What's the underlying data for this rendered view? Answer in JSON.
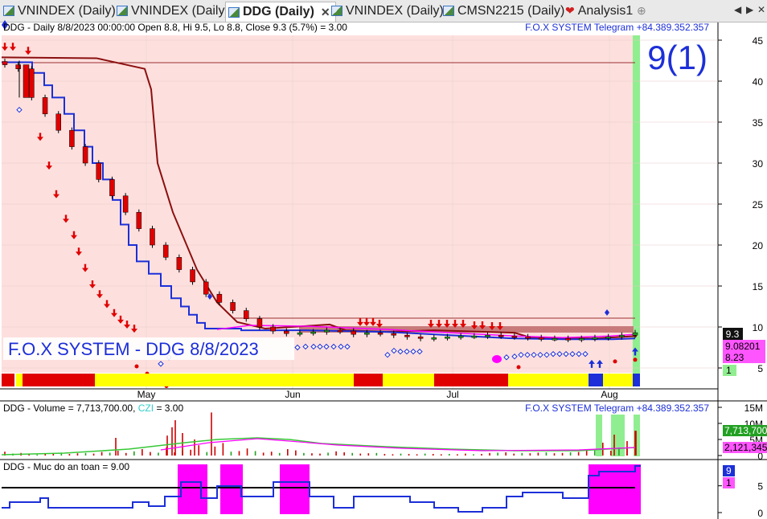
{
  "tabs": [
    {
      "label": "VNINDEX (Daily)",
      "active": false
    },
    {
      "label": "VNINDEX (Daily)",
      "active": false
    },
    {
      "label": "DDG (Daily)",
      "active": true
    },
    {
      "label": "VNINDEX (Daily)",
      "active": false
    },
    {
      "label": "CMSN2215 (Daily)",
      "active": false
    },
    {
      "label": "Analysis1",
      "active": false
    }
  ],
  "tab_add_label": "⊕",
  "nav_labels": [
    "◀",
    "▶",
    "✕"
  ],
  "colors": {
    "price_bg": "#fde0de",
    "up": "#22a022",
    "down": "#e00000",
    "blue_line": "#1c2fd8",
    "darkred_line": "#8b0f0f",
    "magenta": "#ff00ff",
    "green_band": "#90ee90",
    "yellow": "#ffff00",
    "volume_ma": "#36c836"
  },
  "price_panel": {
    "info_text": "DDG - Daily 8/8/2023 00:00:00 Open 8.8, Hi 9.5, Lo 8.8, Close 9.3 (5.7%)  = 3.00",
    "brand_text": "F.O.X SYSTEM Telegram +84.389.352.357",
    "signal_text": "9(1)",
    "watermark": "F.O.X SYSTEM - DDG 8/8/2023",
    "x_labels": [
      "May",
      "Jun",
      "Jul",
      "Aug"
    ],
    "y_ticks": [
      "45",
      "40",
      "35",
      "30",
      "25",
      "20",
      "15",
      "10",
      "5"
    ],
    "last_price_label": "9.3",
    "indicator_label_1": "9.08201",
    "indicator_label_2": "8.23",
    "indicator_label_3": "1"
  },
  "volume_panel": {
    "info_prefix": "DDG - Volume = 7,713,700.00, ",
    "info_czi": "CZI",
    "info_suffix": " = 3.00",
    "brand_text": "F.O.X SYSTEM Telegram +84.389.352.357",
    "y_ticks": [
      "15M",
      "10M",
      "5M",
      "0"
    ],
    "value_label_1": "7,713,700",
    "value_label_2": "2,121,345"
  },
  "safety_panel": {
    "info_text": "DDG - Muc do an toan = 9.00",
    "y_ticks": [
      "5",
      "0"
    ],
    "value_label_1": "9",
    "value_label_2": "1"
  },
  "chart_data": [
    {
      "type": "bar",
      "title": "",
      "series": [
        {
          "name": "DDG",
          "ohlc_last": {
            "open": 8.8,
            "high": 9.5,
            "low": 8.8,
            "close": 9.3
          }
        }
      ],
      "x_labels": [
        "May",
        "Jun",
        "Jul",
        "Aug"
      ],
      "close_approx": [
        42,
        41.5,
        38,
        36,
        34,
        32,
        30,
        28,
        26,
        24,
        22,
        20,
        18.5,
        17,
        15.5,
        14,
        13,
        12,
        11,
        10,
        9.5,
        9.2,
        9.3,
        9.4,
        9.6,
        9.5,
        9.1,
        9.3,
        9.2,
        9.0,
        8.8,
        8.6,
        8.7,
        8.8,
        8.9,
        8.9,
        9.0,
        8.9,
        8.8,
        8.7,
        8.6,
        8.6,
        8.5,
        8.6,
        8.7,
        8.8,
        9.0,
        9.3
      ],
      "resistance_line": 42.3,
      "box_top": 11.1,
      "ylim": [
        0,
        47
      ]
    },
    {
      "type": "bar",
      "title": "",
      "series": [
        {
          "name": "Volume",
          "last": 7713700
        },
        {
          "name": "CZI",
          "last": 3.0
        }
      ],
      "ylim": [
        0,
        15000000
      ]
    },
    {
      "type": "line",
      "title": "",
      "series": [
        {
          "name": "Muc do an toan",
          "last": 9.0
        }
      ],
      "ylim": [
        0,
        9.5
      ]
    }
  ]
}
